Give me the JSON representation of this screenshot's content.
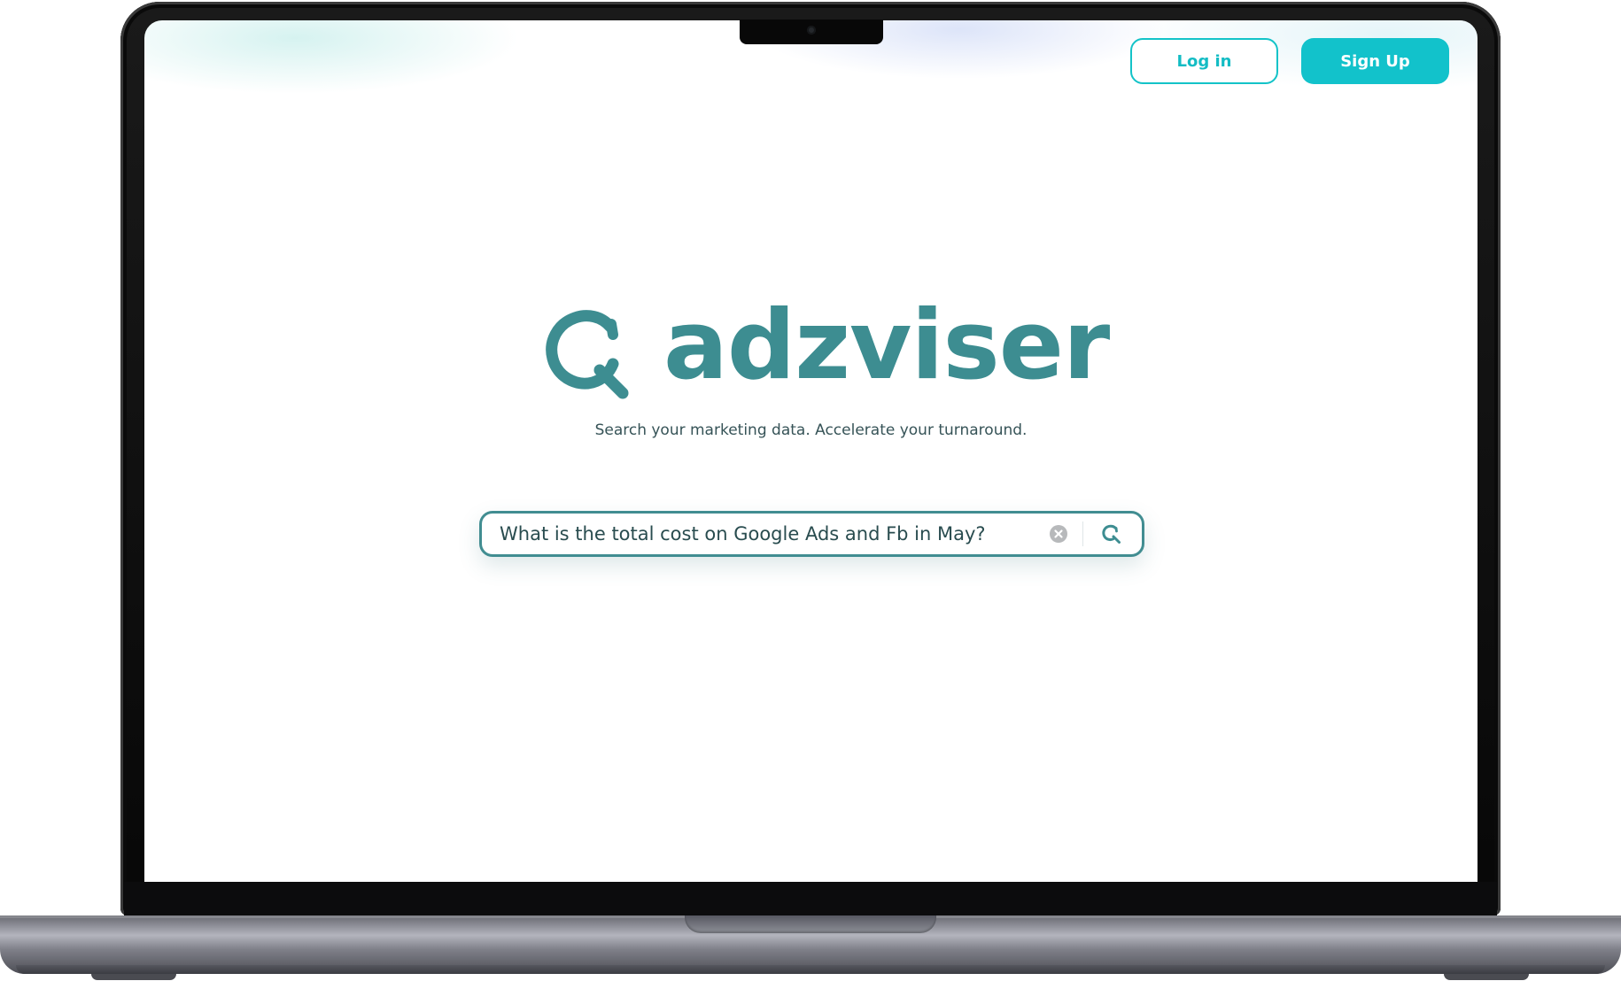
{
  "header": {
    "login_label": "Log in",
    "signup_label": "Sign Up"
  },
  "brand": {
    "name": "adzviser",
    "icon": "magnifier-logo-icon",
    "color": "#3d8d91"
  },
  "tagline": "Search your marketing data. Accelerate your turnaround.",
  "search": {
    "value": "What is the total cost on Google Ads and Fb in May?",
    "clear_icon": "clear-icon",
    "submit_icon": "search-icon"
  },
  "colors": {
    "accent": "#12c2cb",
    "outline": "#418d91",
    "text": "#365357"
  }
}
